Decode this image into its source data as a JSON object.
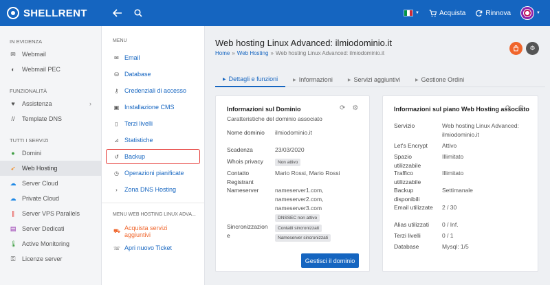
{
  "brand": {
    "name": "SHELLRENT"
  },
  "topbar": {
    "acquista": "Acquista",
    "rinnova": "Rinnova",
    "flag_colors": [
      "#009246",
      "#ffffff",
      "#ce2b37"
    ]
  },
  "sidebar": {
    "sections": [
      {
        "title": "IN EVIDENZA",
        "items": [
          {
            "label": "Webmail",
            "icon": "mail-icon"
          },
          {
            "label": "Webmail PEC",
            "icon": "shield-icon"
          }
        ]
      },
      {
        "title": "FUNZIONALITÀ",
        "items": [
          {
            "label": "Assistenza",
            "icon": "heart-icon"
          },
          {
            "label": "Template DNS",
            "icon": "slash-icon"
          }
        ]
      },
      {
        "title": "TUTTI I SERVIZI",
        "items": [
          {
            "label": "Domini",
            "icon": "globe-icon"
          },
          {
            "label": "Web Hosting",
            "icon": "rocket-icon"
          },
          {
            "label": "Server Cloud",
            "icon": "cloud-icon"
          },
          {
            "label": "Private Cloud",
            "icon": "cloud-icon"
          },
          {
            "label": "Server VPS Parallels",
            "icon": "parallels-icon"
          },
          {
            "label": "Server Dedicati",
            "icon": "server-icon"
          },
          {
            "label": "Active Monitoring",
            "icon": "thermometer-icon"
          },
          {
            "label": "Licenze server",
            "icon": "key-icon"
          }
        ]
      }
    ]
  },
  "submenu": {
    "section1": "MENU",
    "items": [
      {
        "label": "Email",
        "icon": "mail-icon"
      },
      {
        "label": "Database",
        "icon": "database-icon"
      },
      {
        "label": "Credenziali di accesso",
        "icon": "key-icon"
      },
      {
        "label": "Installazione CMS",
        "icon": "install-icon"
      },
      {
        "label": "Terzi livelli",
        "icon": "doc-icon"
      },
      {
        "label": "Statistiche",
        "icon": "chart-icon"
      },
      {
        "label": "Backup",
        "icon": "history-icon"
      },
      {
        "label": "Operazioni pianificate",
        "icon": "clock-icon"
      },
      {
        "label": "Zona DNS Hosting",
        "icon": "chevron-right-icon"
      }
    ],
    "section2": "MENU WEB HOSTING LINUX ADVA...",
    "items2": [
      {
        "label": "Acquista servizi aggiuntivi",
        "icon": "cart-icon"
      },
      {
        "label": "Apri nuovo Ticket",
        "icon": "support-icon"
      }
    ]
  },
  "main": {
    "title": "Web hosting Linux Advanced: ilmiodominio.it",
    "breadcrumb": [
      "Home",
      "Web Hosting",
      "Web hosting Linux Advanced: ilmiodominio.it"
    ],
    "tabs": [
      "Dettagli e funzioni",
      "Informazioni",
      "Servizi aggiuntivi",
      "Gestione Ordini"
    ]
  },
  "domain_card": {
    "title": "Informazioni sul Dominio",
    "subtitle": "Caratteristiche del dominio associato",
    "rows": {
      "nome_label": "Nome dominio",
      "nome_value": "ilmiodominio.it",
      "scadenza_label": "Scadenza",
      "scadenza_value": "23/03/2020",
      "privacy_label": "Whois privacy",
      "privacy_value": "Non attivo",
      "contatto_label": "Contatto Registrant",
      "contatto_value": "Mario Rossi, Mario Rossi",
      "ns_label": "Nameserver",
      "ns1": "nameserver1.com,",
      "ns2": "nameserver2.com,",
      "ns3": "nameserver3.com",
      "dnssec": "DNSSEC non attivo",
      "sync_label": "Sincronizzazione",
      "sync1": "Contatti sincronizzati",
      "sync2": "Nameserver sincronizzati"
    },
    "button": "Gestisci il dominio"
  },
  "plan_card": {
    "title": "Informazioni sul piano Web Hosting associato",
    "rows": {
      "servizio_label": "Servizio",
      "servizio_value1": "Web hosting Linux Advanced:",
      "servizio_value2": "ilmiodominio.it",
      "ssl_label": "Let's Encrypt",
      "ssl_value": "Attivo",
      "spazio_label": "Spazio utilizzabile",
      "spazio_value": "Illimitato",
      "traffico_label": "Traffico utilizzabile",
      "traffico_value": "Illimitato",
      "backup_label": "Backup disponibili",
      "backup_value": "Settimanale",
      "email_label": "Email utilizzate",
      "email_value": "2 / 30",
      "alias_label": "Alias utilizzati",
      "alias_value": "0 / Inf.",
      "terzi_label": "Terzi livelli",
      "terzi_value": "0 / 1",
      "db_label": "Database",
      "db_value": "Mysql: 1/5"
    }
  }
}
